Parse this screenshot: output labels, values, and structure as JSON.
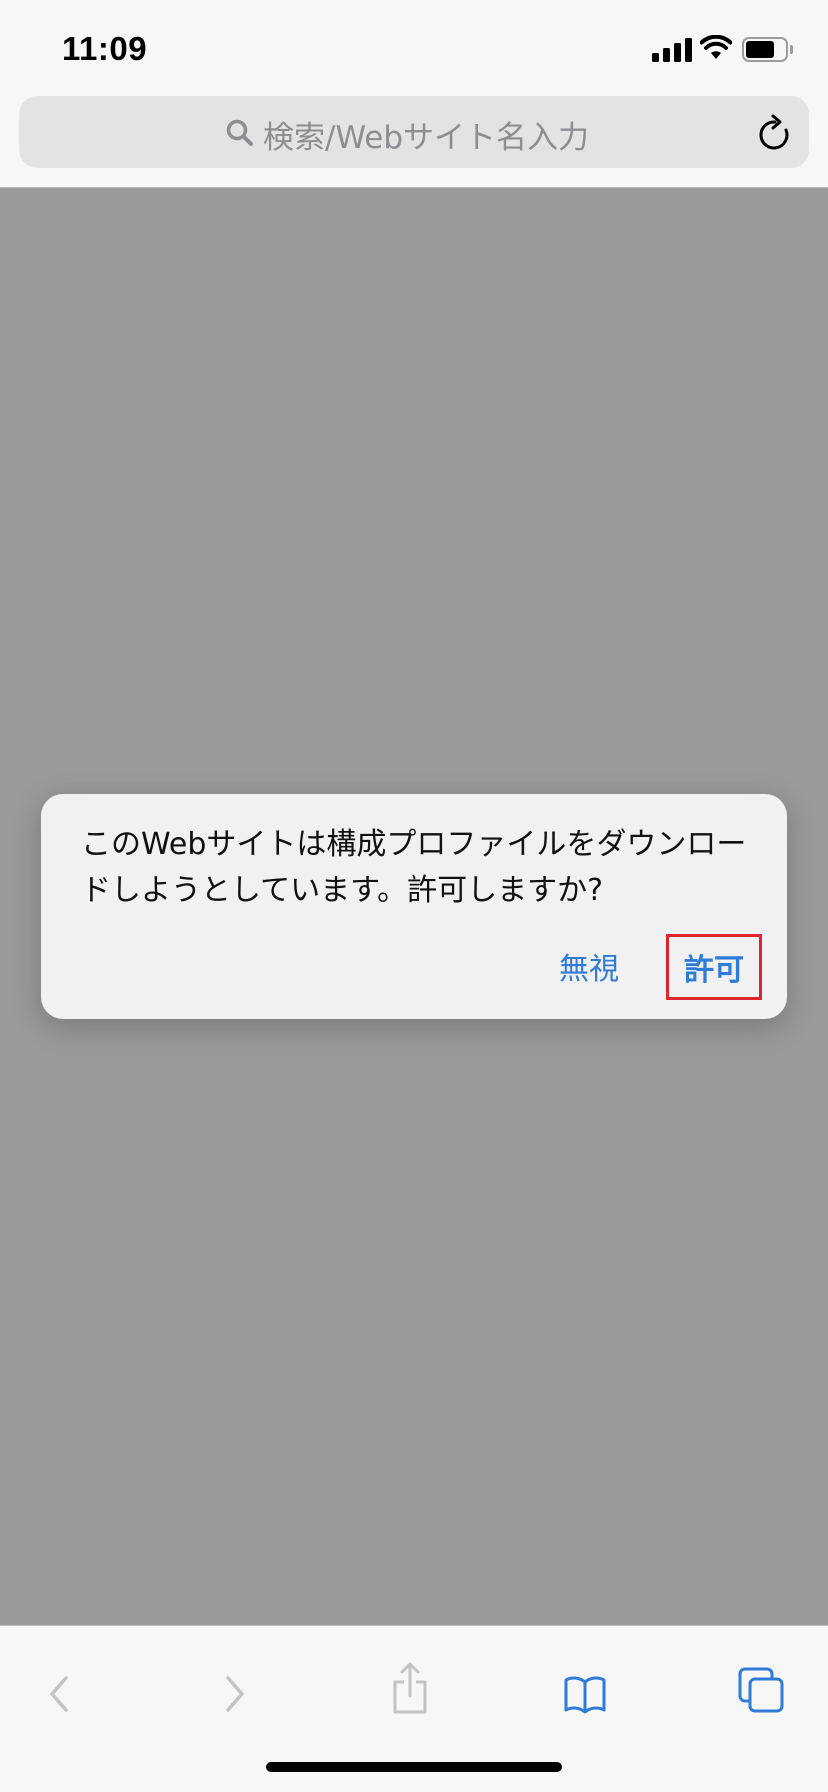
{
  "status_bar": {
    "time": "11:09",
    "icons": [
      "cellular-signal-icon",
      "wifi-icon",
      "battery-icon"
    ]
  },
  "address_bar": {
    "placeholder": "検索/Webサイト名入力",
    "icons": [
      "search-icon",
      "reload-icon"
    ]
  },
  "alert": {
    "message": "このWebサイトは構成プロファイルをダウンロードしようとしています。許可しますか?",
    "ignore_label": "無視",
    "allow_label": "許可",
    "highlight_color": "#e0242b"
  },
  "toolbar": {
    "items": [
      "back-icon",
      "forward-icon",
      "share-icon",
      "bookmarks-icon",
      "tabs-icon"
    ]
  },
  "colors": {
    "accent": "#2f7bd8",
    "overlay": "#9a9a9a",
    "bar_background": "#f7f7f7"
  }
}
